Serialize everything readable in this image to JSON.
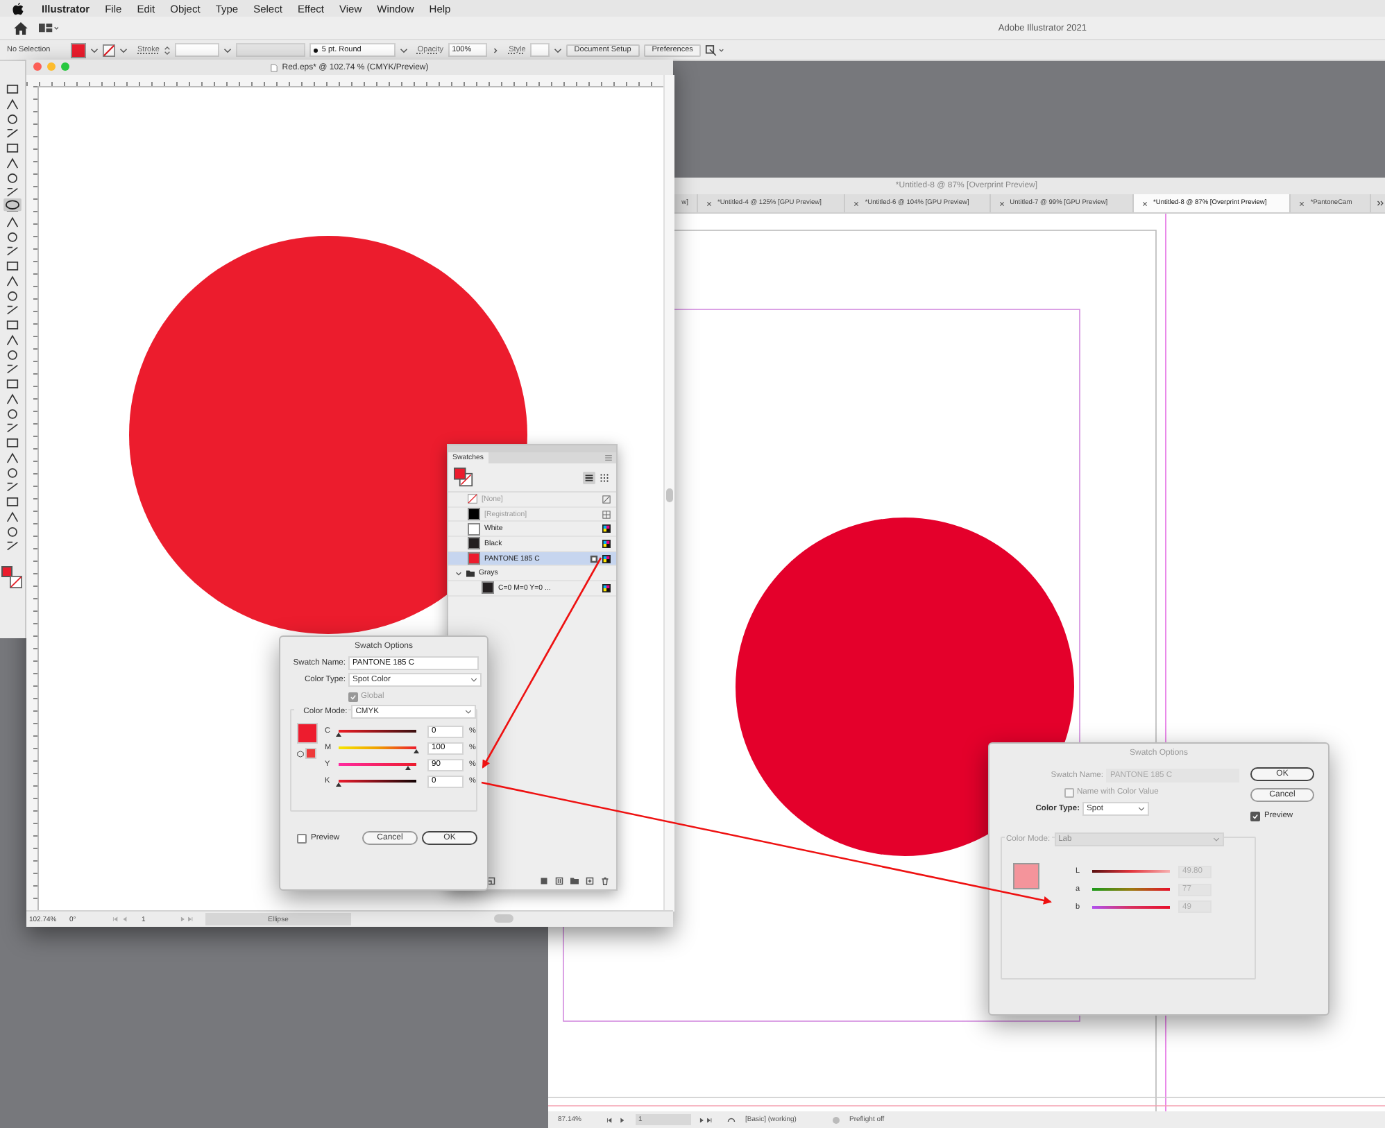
{
  "menu_bar": {
    "app": "Illustrator",
    "items": [
      "File",
      "Edit",
      "Object",
      "Type",
      "Select",
      "Effect",
      "View",
      "Window",
      "Help"
    ]
  },
  "app_title": "Adobe Illustrator 2021",
  "control_bar": {
    "selection": "No Selection",
    "stroke_label": "Stroke",
    "brush": "5 pt. Round",
    "opacity_label": "Opacity",
    "opacity": "100%",
    "style_label": "Style",
    "buttons": [
      "Document Setup",
      "Preferences"
    ]
  },
  "doc_left": {
    "title": "Red.eps* @ 102.74 % (CMYK/Preview)",
    "status": {
      "zoom": "102.74%",
      "rotation": "0°",
      "artboard": "1",
      "tool": "Ellipse"
    }
  },
  "doc_right": {
    "window_title": "*Untitled-8 @ 87% [Overprint Preview]",
    "tabs": [
      {
        "label": "w]",
        "selected": false
      },
      {
        "label": "*Untitled-4 @ 125% [GPU Preview]",
        "selected": false
      },
      {
        "label": "*Untitled-6 @ 104% [GPU Preview]",
        "selected": false
      },
      {
        "label": "Untitled-7 @ 99% [GPU Preview]",
        "selected": false
      },
      {
        "label": "*Untitled-8 @ 87% [Overprint Preview]",
        "selected": true
      },
      {
        "label": "*PantoneCam",
        "selected": false
      }
    ],
    "status": {
      "zoom": "87.14%",
      "artboard": "1",
      "profile": "[Basic] (working)",
      "preflight": "Preflight off"
    }
  },
  "swatches": {
    "title": "Swatches",
    "items": [
      {
        "name": "[None]",
        "kind": "none",
        "selected": false
      },
      {
        "name": "[Registration]",
        "kind": "registration",
        "color": "#000000",
        "selected": false
      },
      {
        "name": "White",
        "kind": "process",
        "color": "#ffffff",
        "selected": false
      },
      {
        "name": "Black",
        "kind": "process",
        "color": "#231f20",
        "selected": false
      },
      {
        "name": "PANTONE 185 C",
        "kind": "spot",
        "color": "#ec1c2d",
        "selected": true
      },
      {
        "name": "Grays",
        "kind": "group",
        "expanded": true,
        "selected": false,
        "children": [
          {
            "name": "C=0 M=0 Y=0 ...",
            "kind": "process",
            "color": "#231f20",
            "selected": false
          }
        ]
      }
    ]
  },
  "dialog_cmyk": {
    "title": "Swatch Options",
    "name_label": "Swatch Name:",
    "name": "PANTONE 185 C",
    "type_label": "Color Type:",
    "type": "Spot Color",
    "global": {
      "label": "Global",
      "checked": true
    },
    "mode_label": "Color Mode:",
    "mode": "CMYK",
    "channels": [
      {
        "label": "C",
        "value": "0",
        "unit": "%",
        "level": 0
      },
      {
        "label": "M",
        "value": "100",
        "unit": "%",
        "level": 1
      },
      {
        "label": "Y",
        "value": "90",
        "unit": "%",
        "level": 0.9
      },
      {
        "label": "K",
        "value": "0",
        "unit": "%",
        "level": 0
      }
    ],
    "preview": {
      "label": "Preview",
      "checked": false
    },
    "buttons": [
      "Cancel",
      "OK"
    ]
  },
  "dialog_lab": {
    "title": "Swatch Options",
    "name_label": "Swatch Name:",
    "name": "PANTONE 185 C",
    "name_with_value": {
      "label": "Name with Color Value",
      "checked": false
    },
    "type_label": "Color Type:",
    "type": "Spot",
    "mode_label": "Color Mode:",
    "mode": "Lab",
    "channels": [
      {
        "label": "L",
        "value": "49.80"
      },
      {
        "label": "a",
        "value": "77"
      },
      {
        "label": "b",
        "value": "49"
      }
    ],
    "buttons": [
      "OK",
      "Cancel"
    ],
    "preview": {
      "label": "Preview",
      "checked": true
    }
  }
}
